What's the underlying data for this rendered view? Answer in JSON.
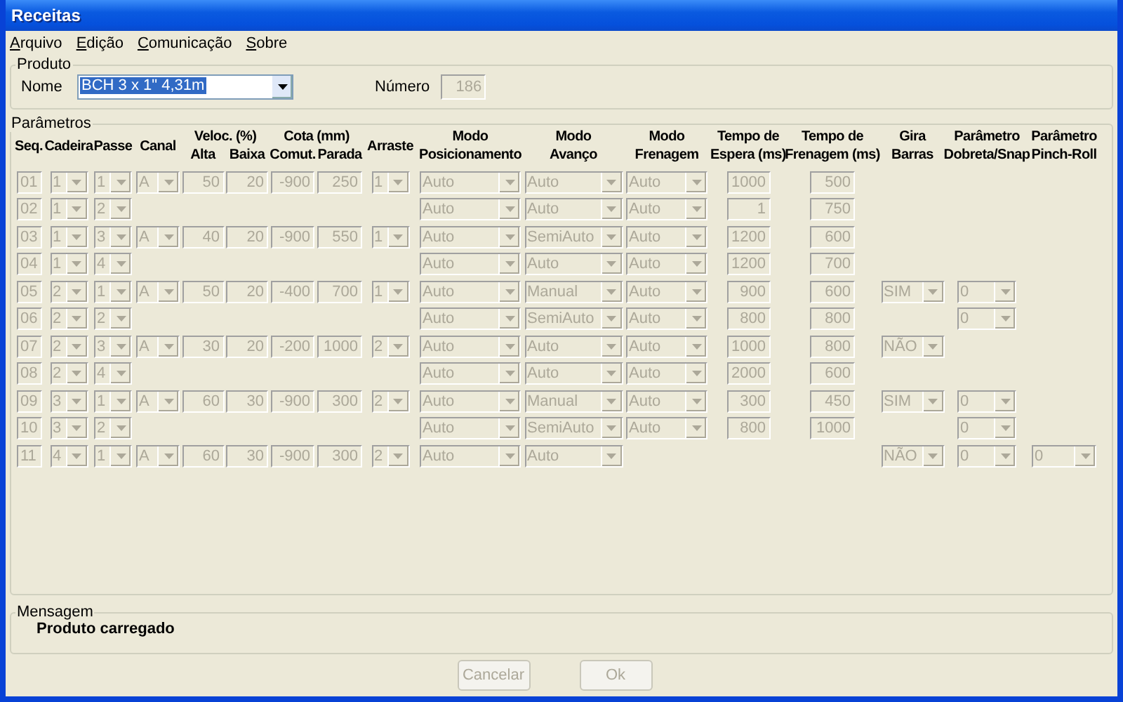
{
  "window": {
    "title": "Receitas"
  },
  "menu": [
    "Arquivo",
    "Edição",
    "Comunicação",
    "Sobre"
  ],
  "produto": {
    "legend": "Produto",
    "nome_label": "Nome",
    "nome_value": "BCH 3 x 1\" 4,31m",
    "nome_text_selected": true,
    "numero_label": "Número",
    "numero_value": "186"
  },
  "parametros": {
    "legend": "Parâmetros",
    "disabled": true,
    "headers": [
      {
        "lines": [
          "Seq."
        ]
      },
      {
        "lines": [
          "Cadeira"
        ]
      },
      {
        "lines": [
          "Passe"
        ]
      },
      {
        "lines": [
          "Canal"
        ]
      },
      {
        "group": "Veloc. (%)",
        "sub": [
          "Alta",
          "Baixa"
        ]
      },
      {
        "group": "Cota (mm)",
        "sub": [
          "Comut.",
          "Parada"
        ]
      },
      {
        "lines": [
          "Arraste"
        ]
      },
      {
        "lines": [
          "Modo",
          "Posicionamento"
        ]
      },
      {
        "lines": [
          "Modo",
          "Avanço"
        ]
      },
      {
        "lines": [
          "Modo",
          "Frenagem"
        ]
      },
      {
        "lines": [
          "Tempo de",
          "Espera (ms)"
        ]
      },
      {
        "lines": [
          "Tempo de",
          "Frenagem (ms)"
        ]
      },
      {
        "lines": [
          "Gira",
          "Barras"
        ]
      },
      {
        "lines": [
          "Parâmetro",
          "Dobreta/Snap"
        ]
      },
      {
        "lines": [
          "Parâmetro",
          "Pinch-Roll"
        ]
      }
    ],
    "rows": [
      {
        "seq": "01",
        "cadeira": "1",
        "passe": "1",
        "canal": "A",
        "alta": "50",
        "baixa": "20",
        "comut": "-900",
        "parada": "250",
        "arraste": "1",
        "posicionamento": "Auto",
        "avanco": "Auto",
        "frenagem": "Auto",
        "espera": "1000",
        "tempo_frenagem": "500"
      },
      {
        "seq": "02",
        "cadeira": "1",
        "passe": "2",
        "posicionamento": "Auto",
        "avanco": "Auto",
        "frenagem": "Auto",
        "espera": "1",
        "tempo_frenagem": "750"
      },
      {
        "seq": "03",
        "cadeira": "1",
        "passe": "3",
        "canal": "A",
        "alta": "40",
        "baixa": "20",
        "comut": "-900",
        "parada": "550",
        "arraste": "1",
        "posicionamento": "Auto",
        "avanco": "SemiAuto",
        "frenagem": "Auto",
        "espera": "1200",
        "tempo_frenagem": "600"
      },
      {
        "seq": "04",
        "cadeira": "1",
        "passe": "4",
        "posicionamento": "Auto",
        "avanco": "Auto",
        "frenagem": "Auto",
        "espera": "1200",
        "tempo_frenagem": "700"
      },
      {
        "seq": "05",
        "cadeira": "2",
        "passe": "1",
        "canal": "A",
        "alta": "50",
        "baixa": "20",
        "comut": "-400",
        "parada": "700",
        "arraste": "1",
        "posicionamento": "Auto",
        "avanco": "Manual",
        "frenagem": "Auto",
        "espera": "900",
        "tempo_frenagem": "600",
        "gira": "SIM",
        "dobreta": "0"
      },
      {
        "seq": "06",
        "cadeira": "2",
        "passe": "2",
        "posicionamento": "Auto",
        "avanco": "SemiAuto",
        "frenagem": "Auto",
        "espera": "800",
        "tempo_frenagem": "800",
        "dobreta": "0"
      },
      {
        "seq": "07",
        "cadeira": "2",
        "passe": "3",
        "canal": "A",
        "alta": "30",
        "baixa": "20",
        "comut": "-200",
        "parada": "1000",
        "arraste": "2",
        "posicionamento": "Auto",
        "avanco": "Auto",
        "frenagem": "Auto",
        "espera": "1000",
        "tempo_frenagem": "800",
        "gira": "NÃO"
      },
      {
        "seq": "08",
        "cadeira": "2",
        "passe": "4",
        "posicionamento": "Auto",
        "avanco": "Auto",
        "frenagem": "Auto",
        "espera": "2000",
        "tempo_frenagem": "600"
      },
      {
        "seq": "09",
        "cadeira": "3",
        "passe": "1",
        "canal": "A",
        "alta": "60",
        "baixa": "30",
        "comut": "-900",
        "parada": "300",
        "arraste": "2",
        "posicionamento": "Auto",
        "avanco": "Manual",
        "frenagem": "Auto",
        "espera": "300",
        "tempo_frenagem": "450",
        "gira": "SIM",
        "dobreta": "0"
      },
      {
        "seq": "10",
        "cadeira": "3",
        "passe": "2",
        "posicionamento": "Auto",
        "avanco": "SemiAuto",
        "frenagem": "Auto",
        "espera": "800",
        "tempo_frenagem": "1000",
        "dobreta": "0"
      },
      {
        "seq": "11",
        "cadeira": "4",
        "passe": "1",
        "canal": "A",
        "alta": "60",
        "baixa": "30",
        "comut": "-900",
        "parada": "300",
        "arraste": "2",
        "posicionamento": "Auto",
        "avanco": "Auto",
        "gira": "NÃO",
        "dobreta": "0",
        "pinch": "0"
      }
    ]
  },
  "mensagem": {
    "legend": "Mensagem",
    "text": "Produto carregado"
  },
  "buttons": [
    {
      "label": "Cancelar",
      "disabled": true
    },
    {
      "label": "Ok",
      "disabled": true
    }
  ]
}
